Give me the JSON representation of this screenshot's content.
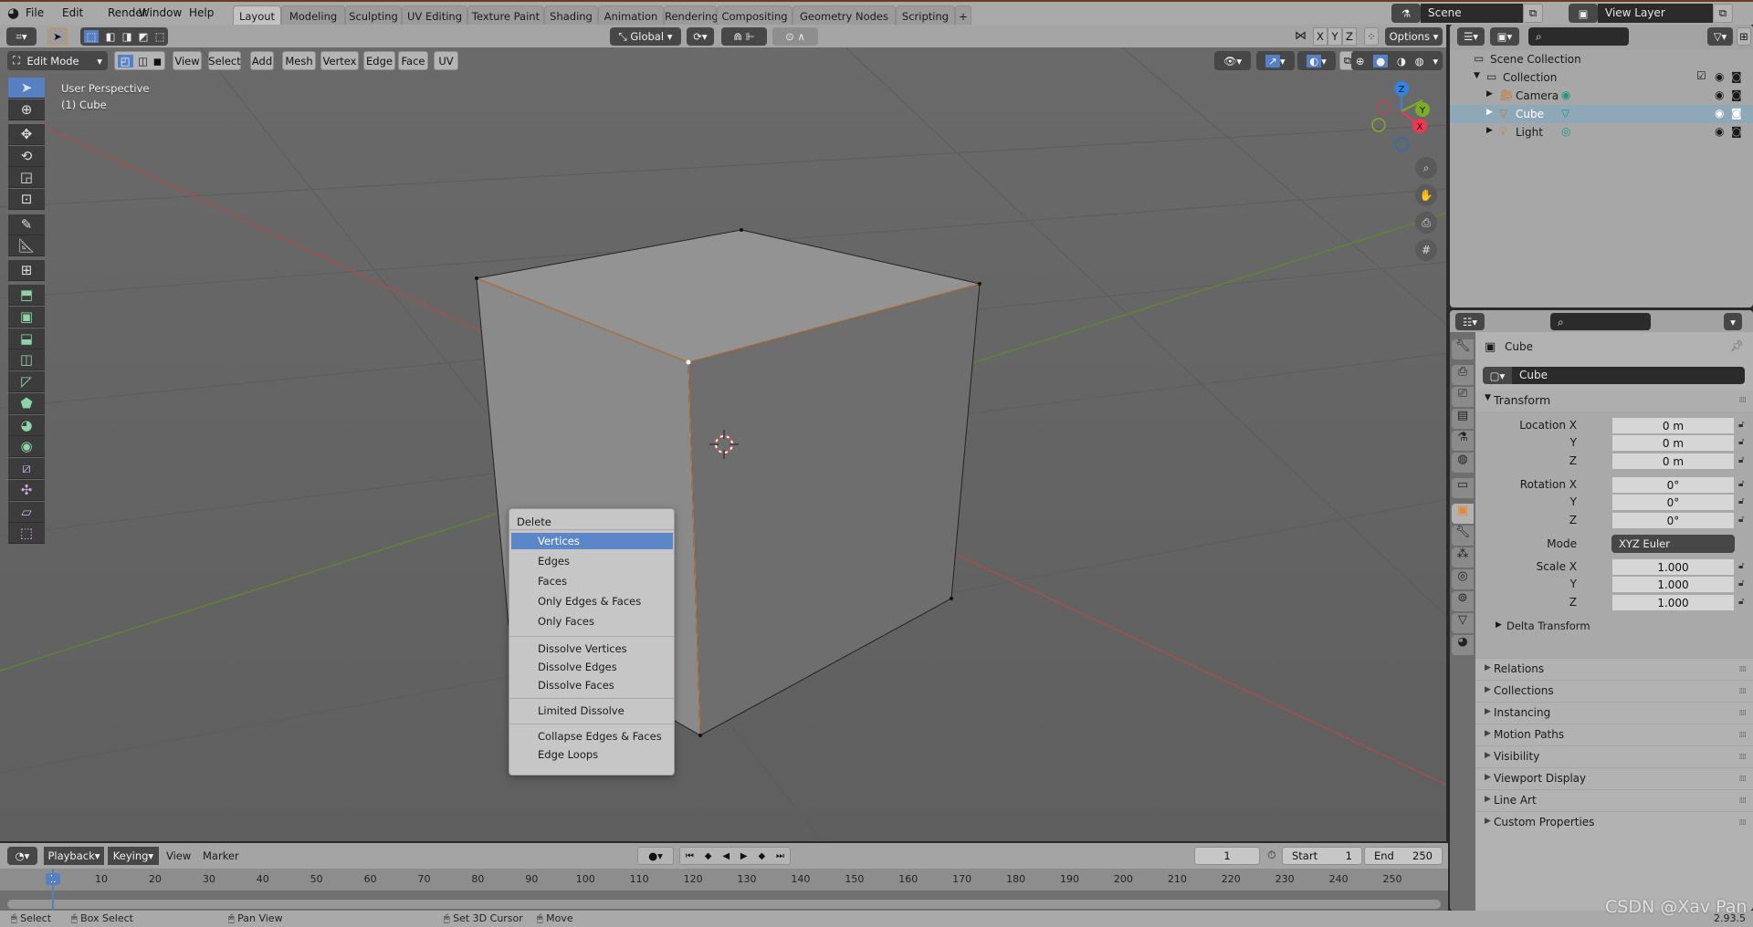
{
  "topbar": {
    "menus": [
      "File",
      "Edit",
      "Render",
      "Window",
      "Help"
    ],
    "tabs": [
      "Layout",
      "Modeling",
      "Sculpting",
      "UV Editing",
      "Texture Paint",
      "Shading",
      "Animation",
      "Rendering",
      "Compositing",
      "Geometry Nodes",
      "Scripting",
      "+"
    ],
    "active_tab": "Layout",
    "scene": "Scene",
    "view_layer": "View Layer"
  },
  "tool_header": {
    "orientation": "Global",
    "axes": [
      "X",
      "Y",
      "Z"
    ],
    "options": "Options"
  },
  "viewport_header": {
    "mode": "Edit Mode",
    "menus": [
      "View",
      "Select",
      "Add",
      "Mesh",
      "Vertex",
      "Edge",
      "Face",
      "UV"
    ]
  },
  "viewport": {
    "perspective": "User Perspective",
    "object": "(1) Cube",
    "gizmo_axes": [
      "Z",
      "Y",
      "X"
    ],
    "colors": {
      "x_axis": "#c44a4a",
      "y_axis": "#6a8a30",
      "selected_edge": "#e38a2a",
      "gizmo_x": "#f0374f",
      "gizmo_y": "#7cae25",
      "gizmo_z": "#2e85e6"
    }
  },
  "context_menu": {
    "title": "Delete",
    "groups": [
      [
        "Vertices",
        "Edges",
        "Faces",
        "Only Edges & Faces",
        "Only Faces"
      ],
      [
        "Dissolve Vertices",
        "Dissolve Edges",
        "Dissolve Faces"
      ],
      [
        "Limited Dissolve"
      ],
      [
        "Collapse Edges & Faces",
        "Edge Loops"
      ]
    ],
    "highlighted": "Vertices"
  },
  "outliner": {
    "rows": [
      {
        "label": "Scene Collection",
        "icon": "scene-collection-icon"
      },
      {
        "label": "Collection",
        "icon": "collection-icon"
      },
      {
        "label": "Camera",
        "icon": "camera-icon"
      },
      {
        "label": "Cube",
        "icon": "mesh-icon",
        "selected": true
      },
      {
        "label": "Light",
        "icon": "light-icon"
      }
    ]
  },
  "properties": {
    "object_name": "Cube",
    "name_field": "Cube",
    "transform": {
      "title": "Transform",
      "location_label": "Location X",
      "location": [
        "0 m",
        "0 m",
        "0 m"
      ],
      "rotation_label": "Rotation X",
      "rotation": [
        "0°",
        "0°",
        "0°"
      ],
      "mode_label": "Mode",
      "mode": "XYZ Euler",
      "scale_label": "Scale X",
      "scale": [
        "1.000",
        "1.000",
        "1.000"
      ],
      "y_label": "Y",
      "z_label": "Z",
      "delta": "Delta Transform"
    },
    "panels": [
      "Relations",
      "Collections",
      "Instancing",
      "Motion Paths",
      "Visibility",
      "Viewport Display",
      "Line Art",
      "Custom Properties"
    ]
  },
  "timeline": {
    "menus": [
      "Playback",
      "Keying",
      "View",
      "Marker"
    ],
    "current_frame": "1",
    "start_label": "Start",
    "start": "1",
    "end_label": "End",
    "end": "250",
    "ticks": [
      "1",
      "10",
      "20",
      "30",
      "40",
      "50",
      "60",
      "70",
      "80",
      "90",
      "100",
      "110",
      "120",
      "130",
      "140",
      "150",
      "160",
      "170",
      "180",
      "190",
      "200",
      "210",
      "220",
      "230",
      "240",
      "250"
    ]
  },
  "statusbar": {
    "items": [
      "Select",
      "Box Select",
      "Pan View",
      "Set 3D Cursor",
      "Move"
    ],
    "version": "2.93.5",
    "watermark": "CSDN @Xav Pan"
  }
}
